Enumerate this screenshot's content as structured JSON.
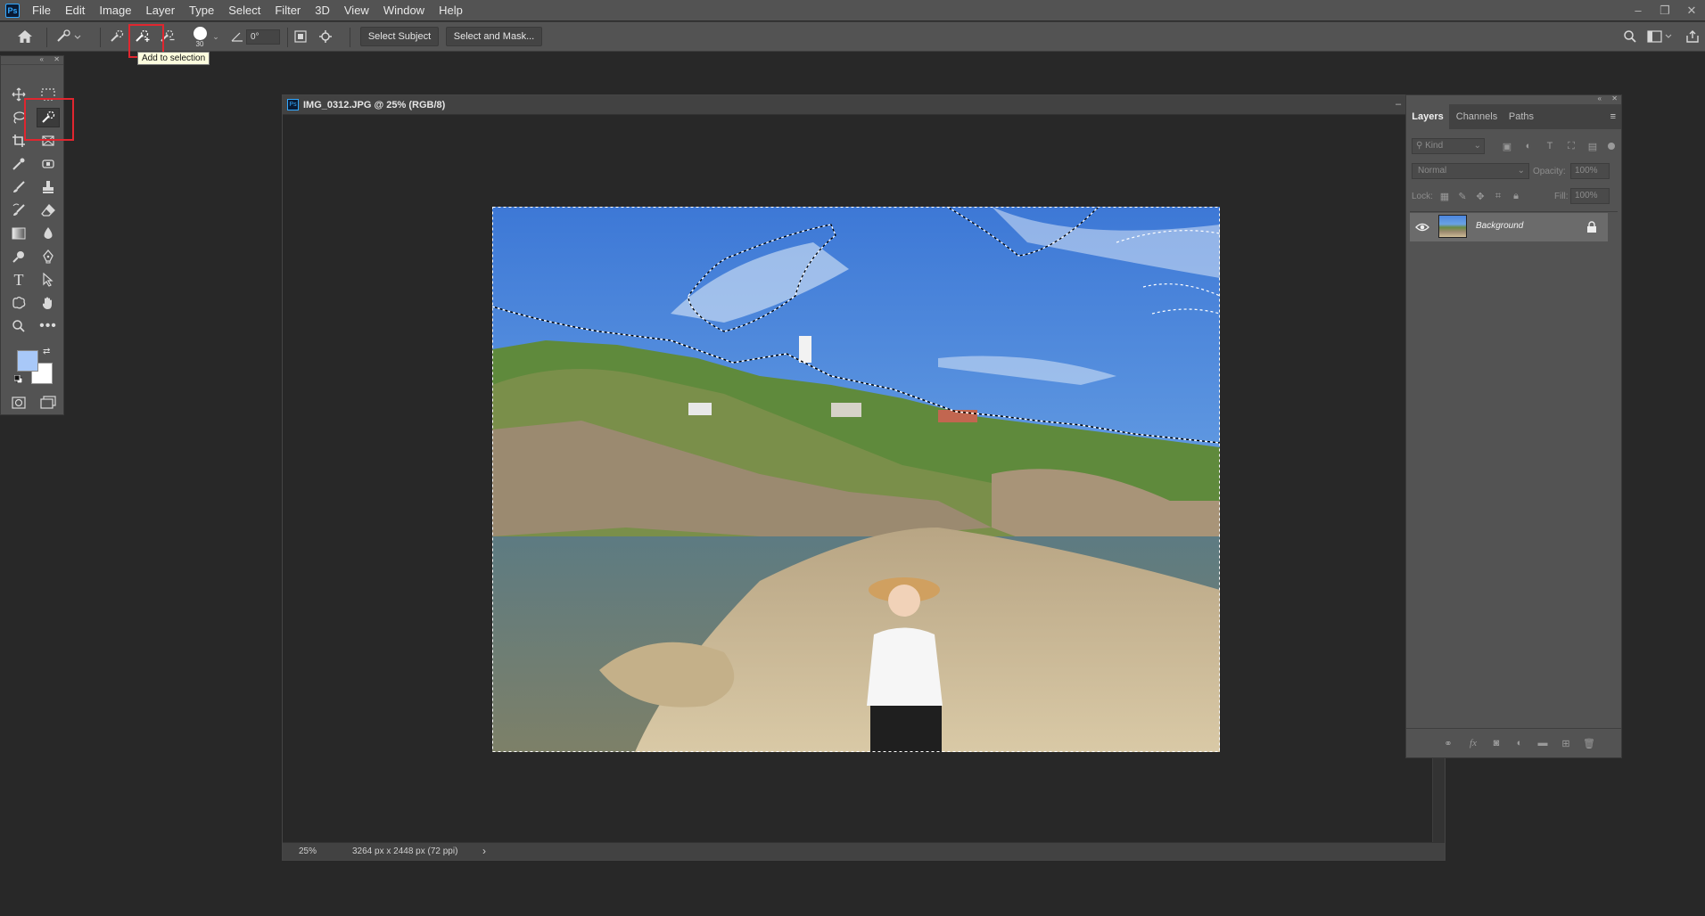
{
  "app": {
    "logo": "Ps"
  },
  "menu": [
    "File",
    "Edit",
    "Image",
    "Layer",
    "Type",
    "Select",
    "Filter",
    "3D",
    "View",
    "Window",
    "Help"
  ],
  "window_controls": {
    "minimize": "–",
    "restore": "❐",
    "close": "✕"
  },
  "options_bar": {
    "brush_size": "30",
    "angle": "0°",
    "select_subject_label": "Select Subject",
    "select_and_mask_label": "Select and Mask...",
    "tooltip": "Add to selection"
  },
  "document": {
    "title": "IMG_0312.JPG @ 25% (RGB/8)",
    "zoom": "25%",
    "info": "3264 px x 2448 px (72 ppi)"
  },
  "colors": {
    "foreground": "#a8c8f8",
    "background": "#ffffff",
    "highlight": "#e0262f"
  },
  "layers_panel": {
    "tabs": [
      "Layers",
      "Channels",
      "Paths"
    ],
    "kind_placeholder": "Kind",
    "blend_mode": "Normal",
    "opacity_label": "Opacity:",
    "opacity_value": "100%",
    "lock_label": "Lock:",
    "fill_label": "Fill:",
    "fill_value": "100%",
    "layers": [
      {
        "name": "Background",
        "visible": true,
        "locked": true
      }
    ]
  }
}
